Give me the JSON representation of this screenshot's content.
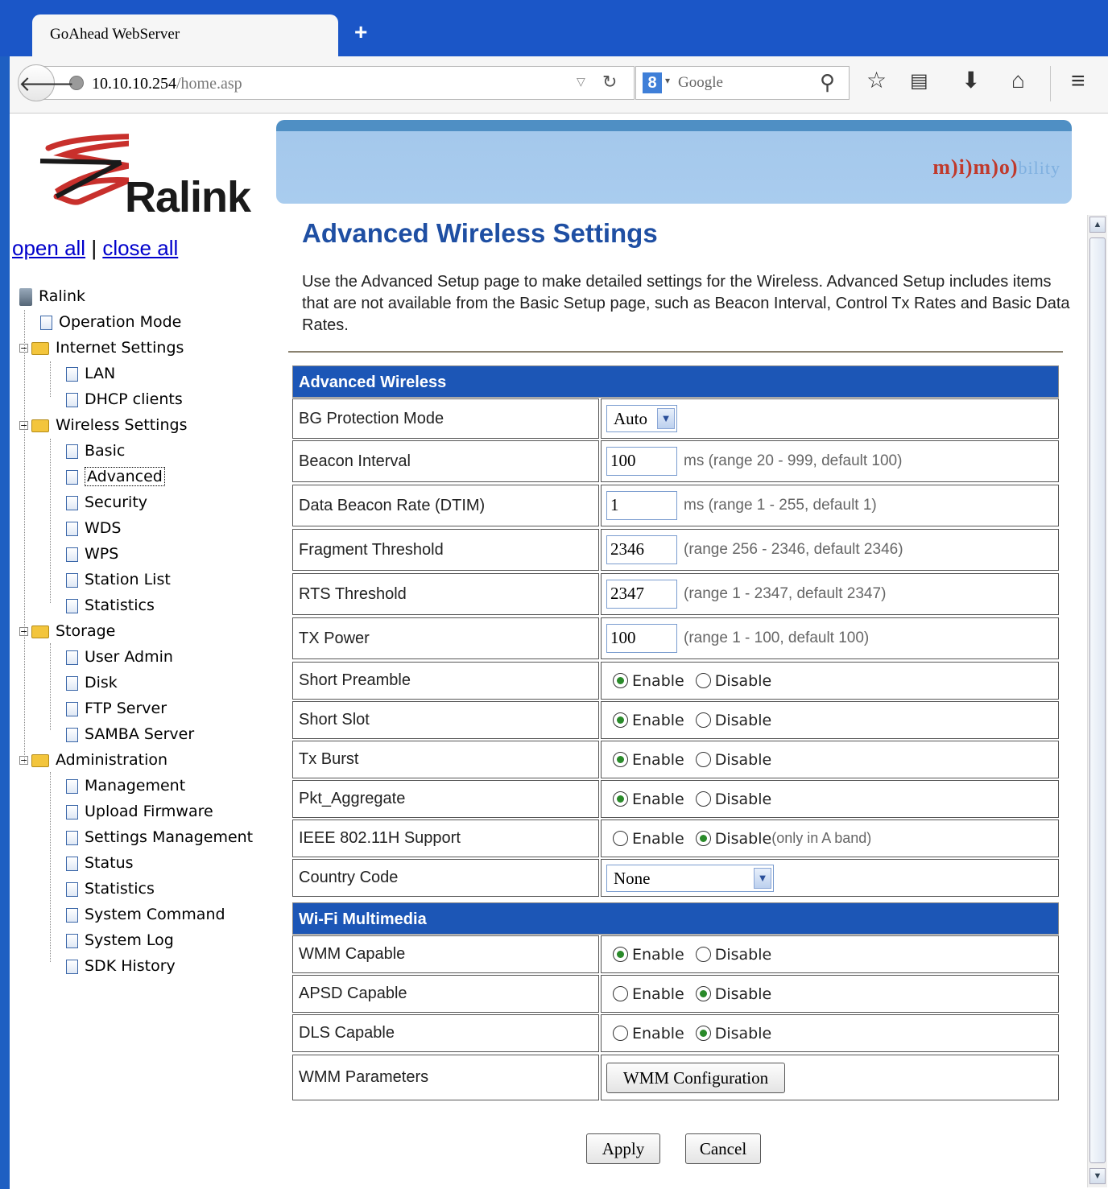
{
  "browser": {
    "tab_title": "GoAhead WebServer",
    "new_tab_symbol": "+",
    "url_host": "10.10.10.254",
    "url_path": "/home.asp",
    "search_engine_glyph": "8",
    "search_placeholder": "Google",
    "icons": [
      "back-icon",
      "globe-icon",
      "reload-icon",
      "search-icon",
      "bookmark-star-icon",
      "reading-list-icon",
      "download-icon",
      "home-icon",
      "menu-icon"
    ]
  },
  "header": {
    "logo_text": "Ralink",
    "banner_text": "m)i)m)o)",
    "banner_tail": "bility"
  },
  "nav": {
    "open_all": "open all",
    "separator": "|",
    "close_all": "close all",
    "root": "Ralink",
    "items": [
      {
        "label": "Operation Mode"
      },
      {
        "label": "Internet Settings"
      },
      {
        "label": "LAN"
      },
      {
        "label": "DHCP clients"
      },
      {
        "label": "Wireless Settings"
      },
      {
        "label": "Basic"
      },
      {
        "label": "Advanced"
      },
      {
        "label": "Security"
      },
      {
        "label": "WDS"
      },
      {
        "label": "WPS"
      },
      {
        "label": "Station List"
      },
      {
        "label": "Statistics"
      },
      {
        "label": "Storage"
      },
      {
        "label": "User Admin"
      },
      {
        "label": "Disk"
      },
      {
        "label": "FTP Server"
      },
      {
        "label": "SAMBA Server"
      },
      {
        "label": "Administration"
      },
      {
        "label": "Management"
      },
      {
        "label": "Upload Firmware"
      },
      {
        "label": "Settings Management"
      },
      {
        "label": "Status"
      },
      {
        "label": "Statistics"
      },
      {
        "label": "System Command"
      },
      {
        "label": "System Log"
      },
      {
        "label": "SDK History"
      }
    ]
  },
  "main": {
    "title": "Advanced Wireless Settings",
    "description": "Use the Advanced Setup page to make detailed settings for the Wireless. Advanced Setup includes items that are not available from the Basic Setup page, such as Beacon Interval, Control Tx Rates and Basic Data Rates.",
    "section_advanced": "Advanced Wireless",
    "section_wmm": "Wi-Fi Multimedia",
    "enable": "Enable",
    "disable": "Disable",
    "bg_protection": {
      "label": "BG Protection Mode",
      "value": "Auto"
    },
    "beacon_interval": {
      "label": "Beacon Interval",
      "value": "100",
      "hint": "ms (range 20 - 999, default 100)"
    },
    "dtim": {
      "label": "Data Beacon Rate (DTIM)",
      "value": "1",
      "hint": "ms (range 1 - 255, default 1)"
    },
    "fragment": {
      "label": "Fragment Threshold",
      "value": "2346",
      "hint": "(range 256 - 2346, default 2346)"
    },
    "rts": {
      "label": "RTS Threshold",
      "value": "2347",
      "hint": "(range 1 - 2347, default 2347)"
    },
    "tx_power": {
      "label": "TX Power",
      "value": "100",
      "hint": "(range 1 - 100, default 100)"
    },
    "short_preamble": {
      "label": "Short Preamble",
      "selected": "Enable"
    },
    "short_slot": {
      "label": "Short Slot",
      "selected": "Enable"
    },
    "tx_burst": {
      "label": "Tx Burst",
      "selected": "Enable"
    },
    "pkt_aggregate": {
      "label": "Pkt_Aggregate",
      "selected": "Enable"
    },
    "ieee_80211h": {
      "label": "IEEE 802.11H Support",
      "selected": "Disable",
      "note": "(only in A band)"
    },
    "country_code": {
      "label": "Country Code",
      "value": "None"
    },
    "wmm_capable": {
      "label": "WMM Capable",
      "selected": "Enable"
    },
    "apsd_capable": {
      "label": "APSD Capable",
      "selected": "Disable"
    },
    "dls_capable": {
      "label": "DLS Capable",
      "selected": "Disable"
    },
    "wmm_parameters": {
      "label": "WMM Parameters",
      "button": "WMM Configuration"
    },
    "apply": "Apply",
    "cancel": "Cancel"
  },
  "colors": {
    "chrome_blue": "#1b56c7",
    "section_blue": "#1c56b6",
    "title_blue": "#1f4fa3"
  }
}
